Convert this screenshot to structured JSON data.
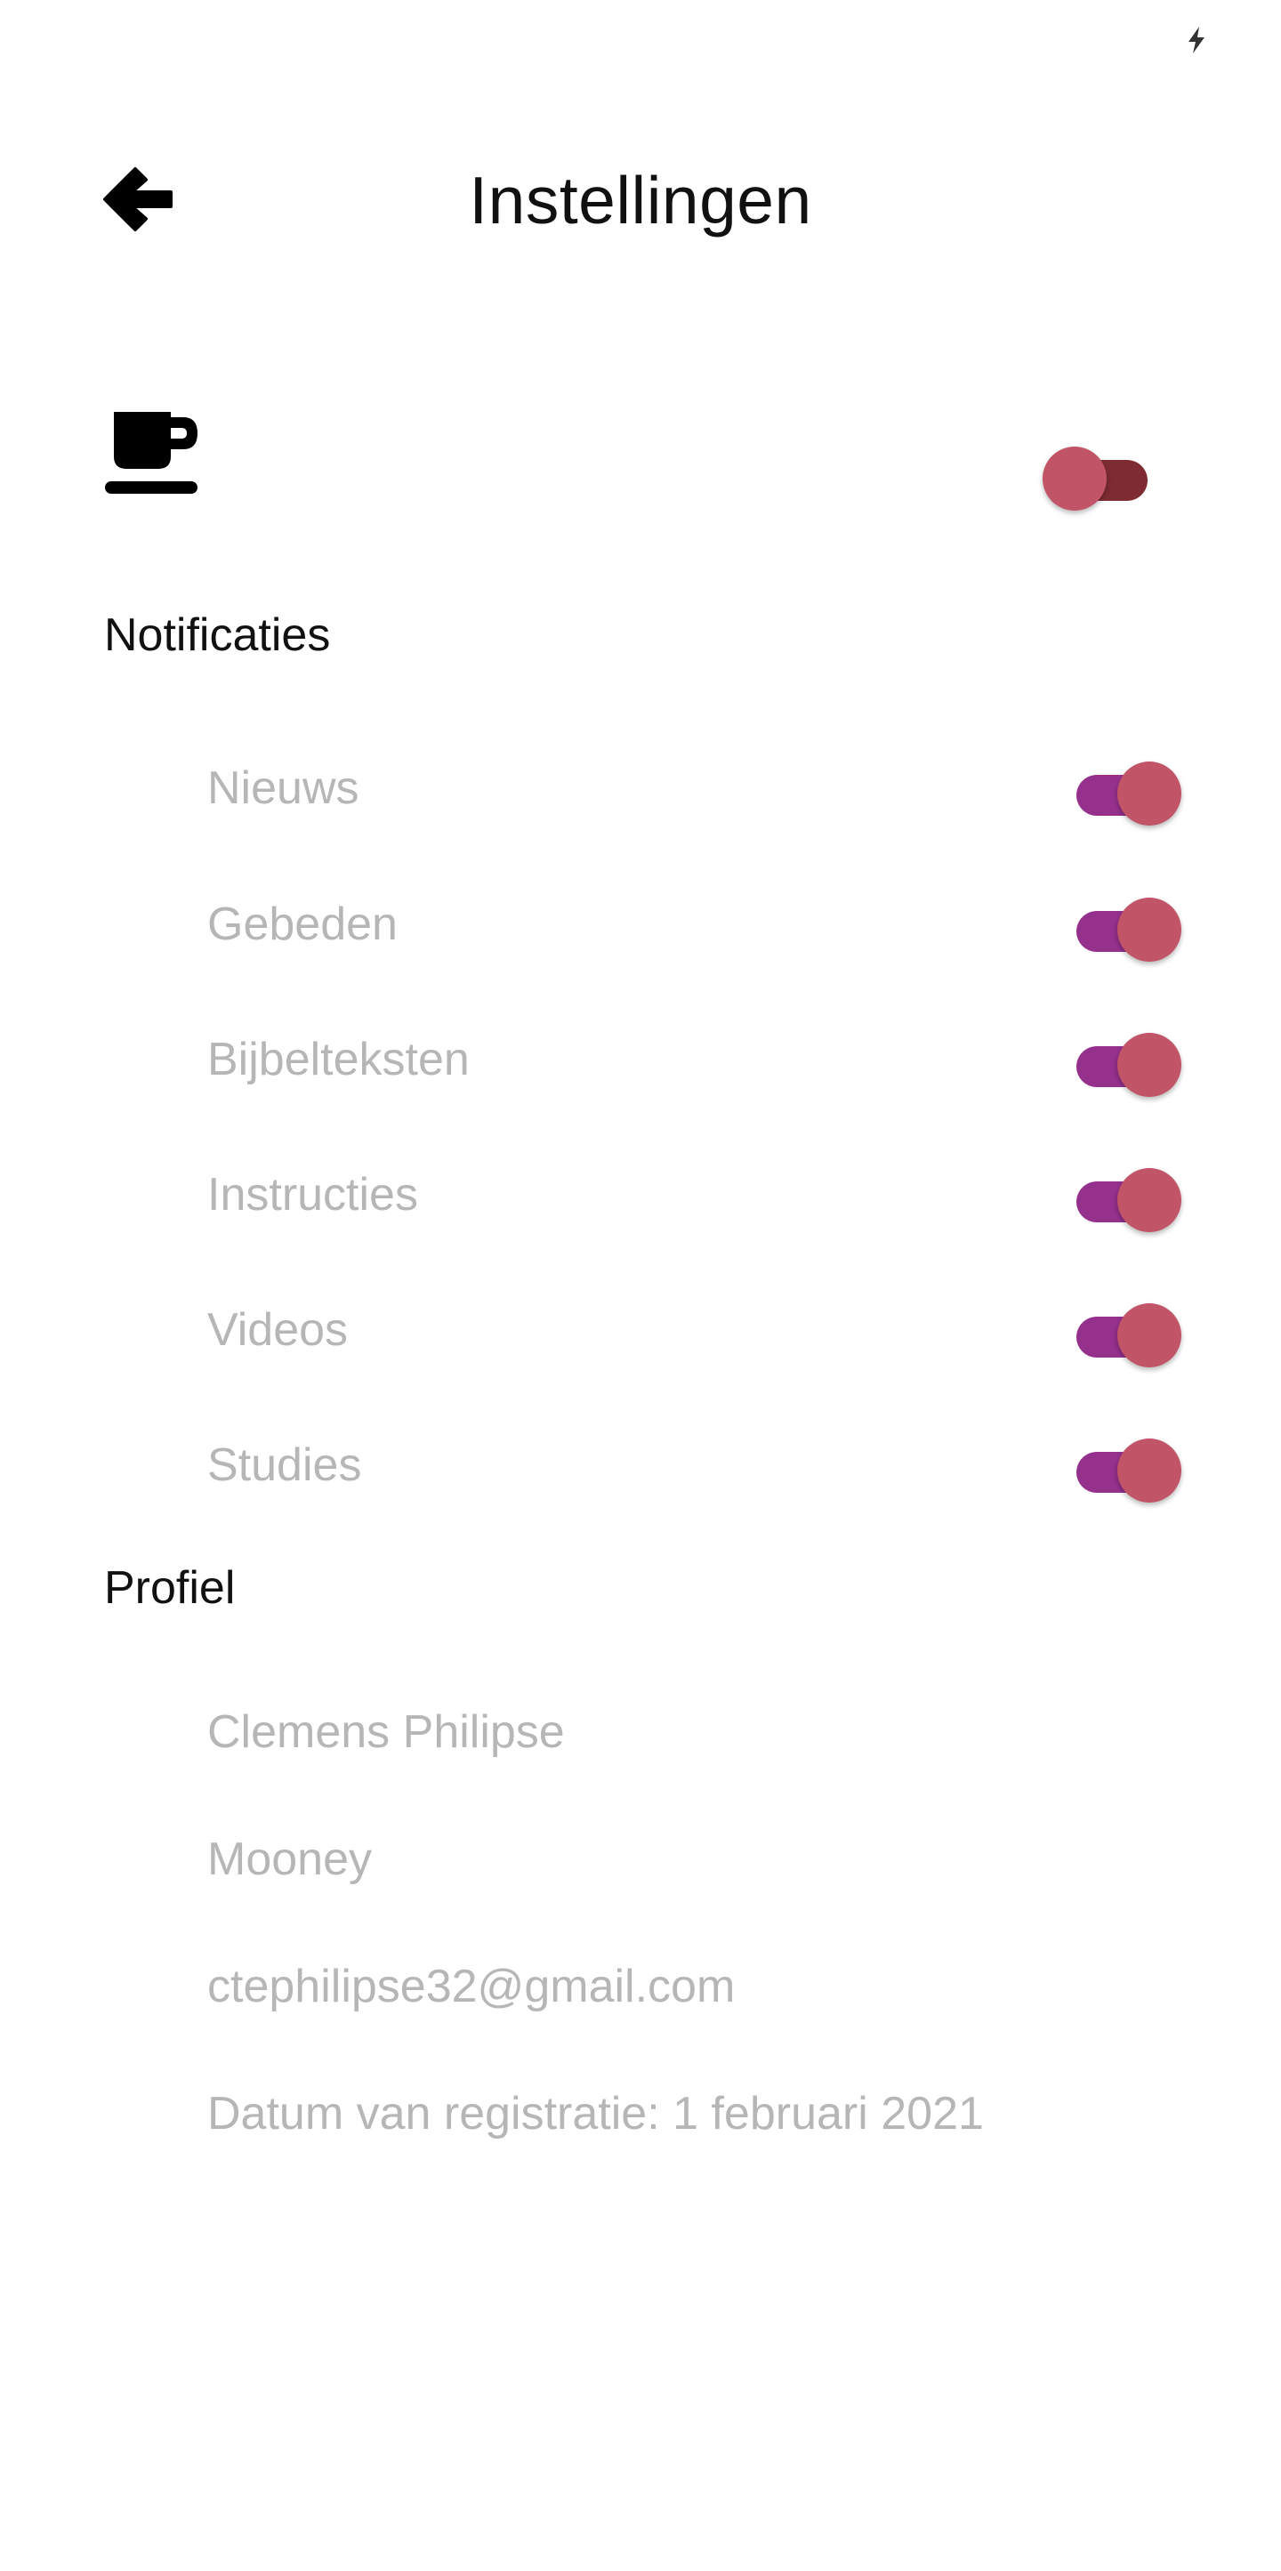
{
  "status_bar": {
    "icon": "bolt-icon"
  },
  "header": {
    "back_icon": "arrow-left-icon",
    "title": "Instellingen"
  },
  "theme": {
    "icon": "coffee-cup-icon",
    "toggle_on": false
  },
  "notifications": {
    "heading": "Notificaties",
    "items": [
      {
        "label": "Nieuws",
        "enabled": true
      },
      {
        "label": "Gebeden",
        "enabled": true
      },
      {
        "label": "Bijbelteksten",
        "enabled": true
      },
      {
        "label": "Instructies",
        "enabled": true
      },
      {
        "label": "Videos",
        "enabled": true
      },
      {
        "label": "Studies",
        "enabled": true
      }
    ]
  },
  "profile": {
    "heading": "Profiel",
    "first_name": "Clemens Philipse",
    "last_name": "Mooney",
    "email": "ctephilipse32@gmail.com",
    "registration": "Datum van registratie: 1 februari 2021"
  },
  "colors": {
    "toggle_thumb": "#c15467",
    "toggle_track_on": "#96308d",
    "toggle_track_off": "#7e2b32",
    "muted_text": "#b6b6b6",
    "text": "#111111",
    "background": "#ffffff"
  }
}
